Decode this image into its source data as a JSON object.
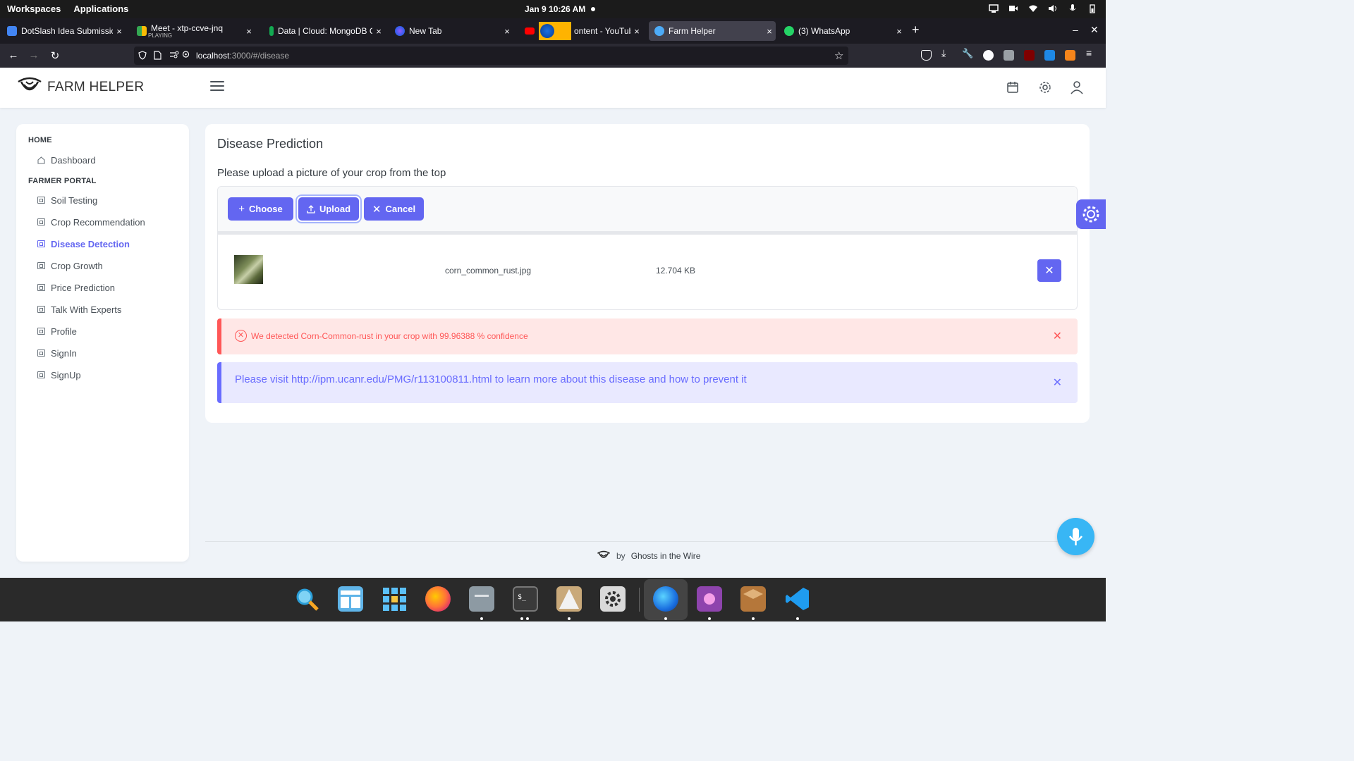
{
  "system": {
    "workspaces": "Workspaces",
    "applications": "Applications",
    "clock": "Jan 9  10:26 AM"
  },
  "browser": {
    "tabs": [
      {
        "title": "DotSlash Idea Submission -",
        "active": false
      },
      {
        "title": "Meet - xtp-ccve-jnq",
        "subtitle": "PLAYING",
        "active": false
      },
      {
        "title": "Data | Cloud: MongoDB Clou",
        "active": false
      },
      {
        "title": "New Tab",
        "active": false
      },
      {
        "title": "ontent - YouTube",
        "active": false
      },
      {
        "title": "Farm Helper",
        "active": true
      },
      {
        "title": "(3) WhatsApp",
        "active": false
      }
    ],
    "url_host": "localhost",
    "url_path": ":3000/#/disease"
  },
  "app": {
    "brand": "FARM HELPER",
    "sidebar": {
      "section_home": "HOME",
      "dashboard": "Dashboard",
      "section_portal": "FARMER PORTAL",
      "items": [
        {
          "label": "Soil Testing",
          "active": false
        },
        {
          "label": "Crop Recommendation",
          "active": false
        },
        {
          "label": "Disease Detection",
          "active": true
        },
        {
          "label": "Crop Growth",
          "active": false
        },
        {
          "label": "Price Prediction",
          "active": false
        },
        {
          "label": "Talk With Experts",
          "active": false
        },
        {
          "label": "Profile",
          "active": false
        },
        {
          "label": "SignIn",
          "active": false
        },
        {
          "label": "SignUp",
          "active": false
        }
      ]
    },
    "main": {
      "title": "Disease Prediction",
      "instruction": "Please upload a picture of your crop from the top",
      "buttons": {
        "choose": "Choose",
        "upload": "Upload",
        "cancel": "Cancel"
      },
      "file": {
        "name": "corn_common_rust.jpg",
        "size": "12.704 KB"
      },
      "error_message": "We detected Corn-Common-rust in your crop with 99.96388 % confidence",
      "info_message": "Please visit http://ipm.ucanr.edu/PMG/r113100811.html to learn more about this disease and how to prevent it"
    },
    "footer": {
      "by": "by",
      "team": "Ghosts in the Wire"
    }
  },
  "colors": {
    "primary": "#6366f1",
    "error": "#ff5757",
    "info": "#696cff",
    "mic": "#38b6f5"
  }
}
